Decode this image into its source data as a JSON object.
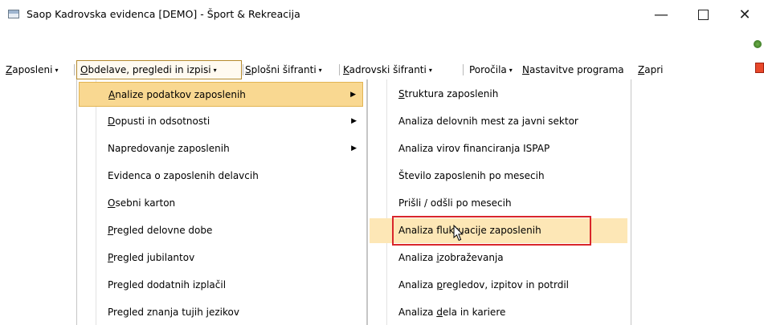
{
  "window": {
    "title": "Saop Kadrovska evidenca  [DEMO] - Šport & Rekreacija",
    "minimize": "—",
    "close": "✕"
  },
  "menubar": {
    "items": [
      {
        "u": "Z",
        "rest": "aposleni",
        "caret": "▾"
      },
      {
        "u": "O",
        "rest": "bdelave, pregledi in izpisi",
        "caret": "▾"
      },
      {
        "u": "S",
        "rest": "plošni šifranti",
        "caret": "▾"
      },
      {
        "u": "K",
        "rest": "adrovski šifranti",
        "caret": "▾"
      },
      {
        "u": "",
        "rest": "Poročila",
        "caret": "▾"
      },
      {
        "u": "N",
        "rest": "astavitve programa",
        "caret": ""
      },
      {
        "u": "Z",
        "rest": "apri",
        "caret": ""
      }
    ]
  },
  "menu1": {
    "items": [
      {
        "u": "A",
        "rest": "nalize podatkov zaposlenih",
        "arrow": "▶"
      },
      {
        "u": "D",
        "rest": "opusti in odsotnosti",
        "arrow": "▶"
      },
      {
        "u": "",
        "rest": "Napredovanje zaposlenih",
        "arrow": "▶"
      },
      {
        "u": "",
        "rest": "Evidenca o zaposlenih delavcih",
        "arrow": ""
      },
      {
        "u": "O",
        "rest": "sebni karton",
        "arrow": ""
      },
      {
        "u": "P",
        "rest": "regled delovne dobe",
        "arrow": ""
      },
      {
        "u": "P",
        "rest": "regled jubilantov",
        "arrow": ""
      },
      {
        "u": "",
        "rest": "Pregled dodatnih izplačil",
        "arrow": ""
      },
      {
        "u": "",
        "rest": "Pregled znanja tujih jezikov",
        "arrow": ""
      }
    ]
  },
  "menu2": {
    "items": [
      {
        "pre": "",
        "u": "S",
        "rest": "truktura zaposlenih"
      },
      {
        "pre": "",
        "u": "",
        "rest": "Analiza delovnih mest za javni sektor"
      },
      {
        "pre": "",
        "u": "",
        "rest": "Analiza virov financiranja ISPAP"
      },
      {
        "pre": "",
        "u": "",
        "rest": "Število zaposlenih po mesecih"
      },
      {
        "pre": "",
        "u": "",
        "rest": "Prišli / odšli po mesecih"
      },
      {
        "pre": "",
        "u": "",
        "rest": "Analiza fluktuacije zaposlenih"
      },
      {
        "pre": "Analiza ",
        "u": "i",
        "rest": "zobraževanja"
      },
      {
        "pre": "Analiza ",
        "u": "p",
        "rest": "regledov, izpitov in potrdil"
      },
      {
        "pre": "Analiza ",
        "u": "d",
        "rest": "ela in kariere"
      }
    ]
  },
  "colors": {
    "highlight": "#f9d891",
    "hover": "#fde7b6",
    "callout": "#d9262b"
  }
}
